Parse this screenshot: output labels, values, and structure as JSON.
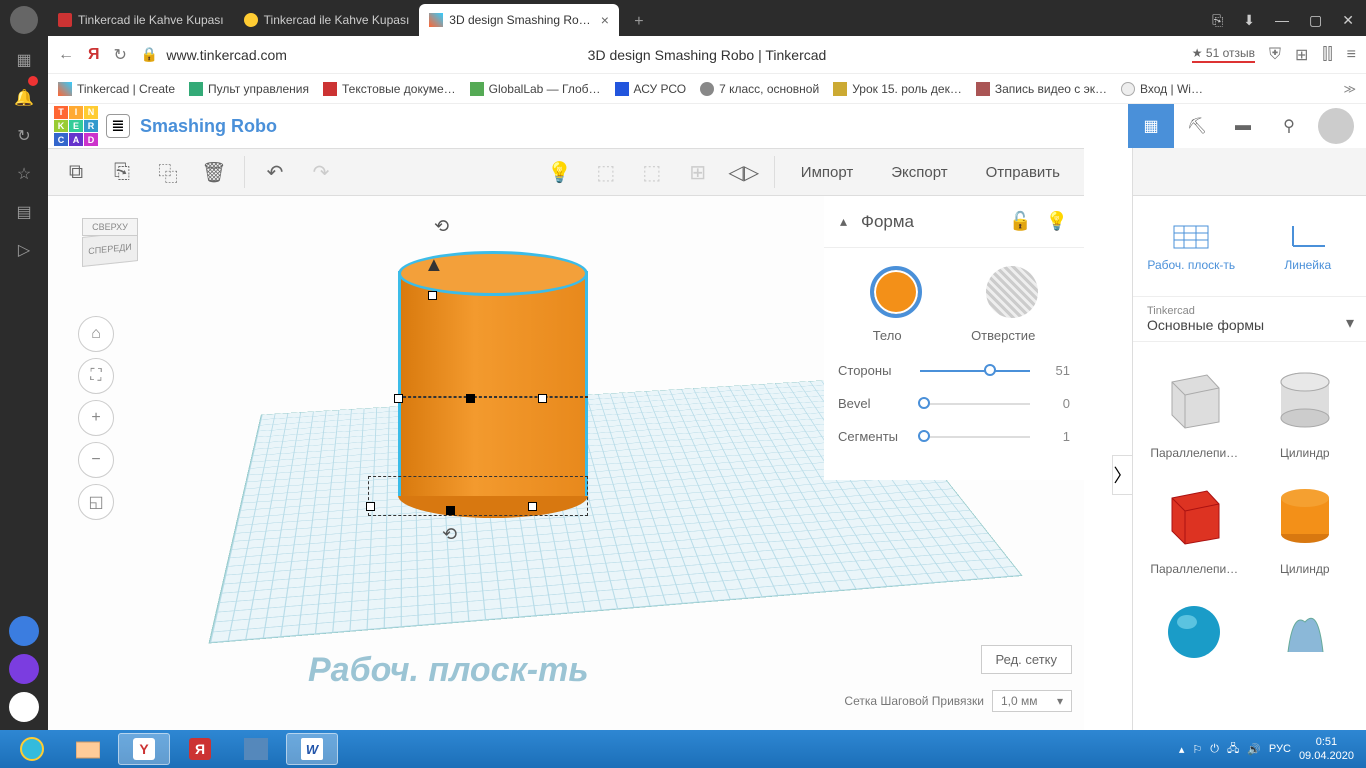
{
  "browser": {
    "tabs": [
      {
        "label": "Tinkercad ile Kahve Kupası"
      },
      {
        "label": "Tinkercad ile Kahve Kupası"
      },
      {
        "label": "3D design Smashing Ro…",
        "active": true
      }
    ],
    "url_host": "www.tinkercad.com",
    "page_title": "3D design Smashing Robo | Tinkercad",
    "reviews": "★ 51 отзыв",
    "bookmarks": [
      "Tinkercad | Create",
      "Пульт управления",
      "Текстовые докуме…",
      "GlobalLab — Глоб…",
      "АСУ РСО",
      "7 класс, основной",
      "Урок 15. роль дек…",
      "Запись видео с эк…",
      "Вход | Wi…"
    ]
  },
  "tinkercad": {
    "project_name": "Smashing Robo",
    "toolbar": {
      "import": "Импорт",
      "export": "Экспорт",
      "send": "Отправить"
    },
    "shape_panel": {
      "title": "Форма",
      "solid": "Тело",
      "hole": "Отверстие",
      "props": [
        {
          "name": "Стороны",
          "value": "51",
          "pos": 78
        },
        {
          "name": "Bevel",
          "value": "0",
          "pos": 0
        },
        {
          "name": "Сегменты",
          "value": "1",
          "pos": 0
        }
      ]
    },
    "library": {
      "quick": [
        {
          "label": "Рабоч. плоск-ть"
        },
        {
          "label": "Линейка"
        }
      ],
      "category_sub": "Tinkercad",
      "category_main": "Основные формы",
      "shapes": [
        {
          "label": "Параллелепи…"
        },
        {
          "label": "Цилиндр"
        },
        {
          "label": "Параллелепи…"
        },
        {
          "label": "Цилиндр"
        }
      ]
    },
    "viewcube": {
      "top": "СВЕРХУ",
      "front": "СПЕРЕДИ"
    },
    "workplane_label": "Рабоч. плоск-ть",
    "edit_grid": "Ред. сетку",
    "snap": {
      "label": "Сетка Шаговой Привязки",
      "value": "1,0 мм"
    }
  },
  "system": {
    "lang": "РУС",
    "time": "0:51",
    "date": "09.04.2020"
  }
}
